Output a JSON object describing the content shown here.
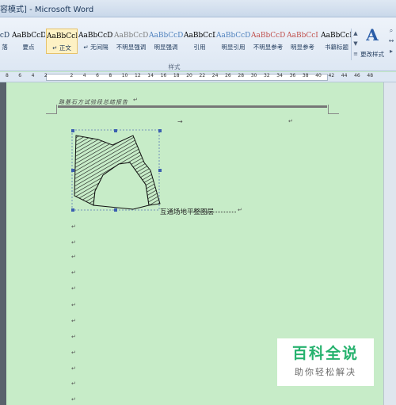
{
  "window": {
    "title": "容模式] - Microsoft Word"
  },
  "ribbon": {
    "styles": [
      {
        "preview": "cD",
        "name": "落",
        "color": "#1e395b"
      },
      {
        "preview": "AaBbCcD",
        "name": "要点",
        "color": "#000000"
      },
      {
        "preview": "AaBbCcDi",
        "name": "正文",
        "color": "#000000",
        "active": true
      },
      {
        "preview": "AaBbCcDi",
        "name": "无间隔",
        "color": "#000000"
      },
      {
        "preview": "AaBbCcDi",
        "name": "不明显强调",
        "color": "#7f7f7f"
      },
      {
        "preview": "AaBbCcDi",
        "name": "明显强调",
        "color": "#4f81bd"
      },
      {
        "preview": "AaBbCcDi",
        "name": "引用",
        "color": "#000000"
      },
      {
        "preview": "AaBbCcDi",
        "name": "明显引用",
        "color": "#4f81bd"
      },
      {
        "preview": "AaBbCcDi",
        "name": "不明显参考",
        "color": "#c0504d"
      },
      {
        "preview": "AaBbCcI",
        "name": "明显参考",
        "color": "#c0504d"
      },
      {
        "preview": "AaBbCcI",
        "name": "书籍标题",
        "color": "#000000"
      }
    ],
    "group_label": "样式",
    "change_styles_label": "更改样式"
  },
  "ruler": {
    "ticks": [
      "8",
      "6",
      "4",
      "2",
      "",
      "2",
      "4",
      "6",
      "8",
      "10",
      "12",
      "14",
      "16",
      "18",
      "20",
      "22",
      "24",
      "26",
      "28",
      "30",
      "32",
      "34",
      "36",
      "38",
      "40",
      "42",
      "44",
      "46",
      "48"
    ]
  },
  "document": {
    "header": "路基石方试验段总结报告",
    "caption": "互通场地平整图层"
  },
  "watermark": {
    "title": "百科全说",
    "subtitle": "助你轻松解决"
  }
}
